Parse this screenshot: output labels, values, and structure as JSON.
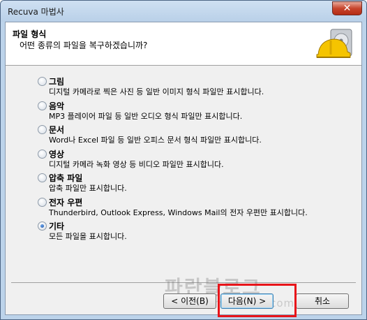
{
  "window": {
    "title": "Recuva 마법사",
    "close_label": "✕"
  },
  "header": {
    "title": "파일 형식",
    "subtitle": "어떤 종류의 파일을 복구하겠습니까?",
    "icon": "hard-drive-hardhat-icon"
  },
  "options": [
    {
      "label": "그림",
      "desc": "디지털 카메라로 찍은 사진 등 일반 이미지 형식 파일만 표시합니다.",
      "checked": false
    },
    {
      "label": "음악",
      "desc": "MP3 플레이어 파일 등 일반 오디오 형식 파일만 표시합니다.",
      "checked": false
    },
    {
      "label": "문서",
      "desc": "Word나 Excel 파일 등 일반 오피스 문서 형식 파일만 표시합니다.",
      "checked": false
    },
    {
      "label": "영상",
      "desc": "디지털 카메라 녹화 영상 등 비디오 파일만 표시합니다.",
      "checked": false
    },
    {
      "label": "압축 파일",
      "desc": "압축 파일만 표시합니다.",
      "checked": false
    },
    {
      "label": "전자 우편",
      "desc": "Thunderbird, Outlook Express, Windows Mail의 전자 우편만 표시합니다.",
      "checked": false
    },
    {
      "label": "기타",
      "desc": "모든 파일을 표시합니다.",
      "checked": true
    }
  ],
  "buttons": {
    "prev": "< 이전(B)",
    "next": "다음(N) >",
    "cancel": "취소"
  },
  "watermark": {
    "text": "파란블로그",
    "url": "parandm.tistory.com"
  },
  "colors": {
    "highlight": "#e8141a",
    "title_bar": "#bcd3ea"
  }
}
